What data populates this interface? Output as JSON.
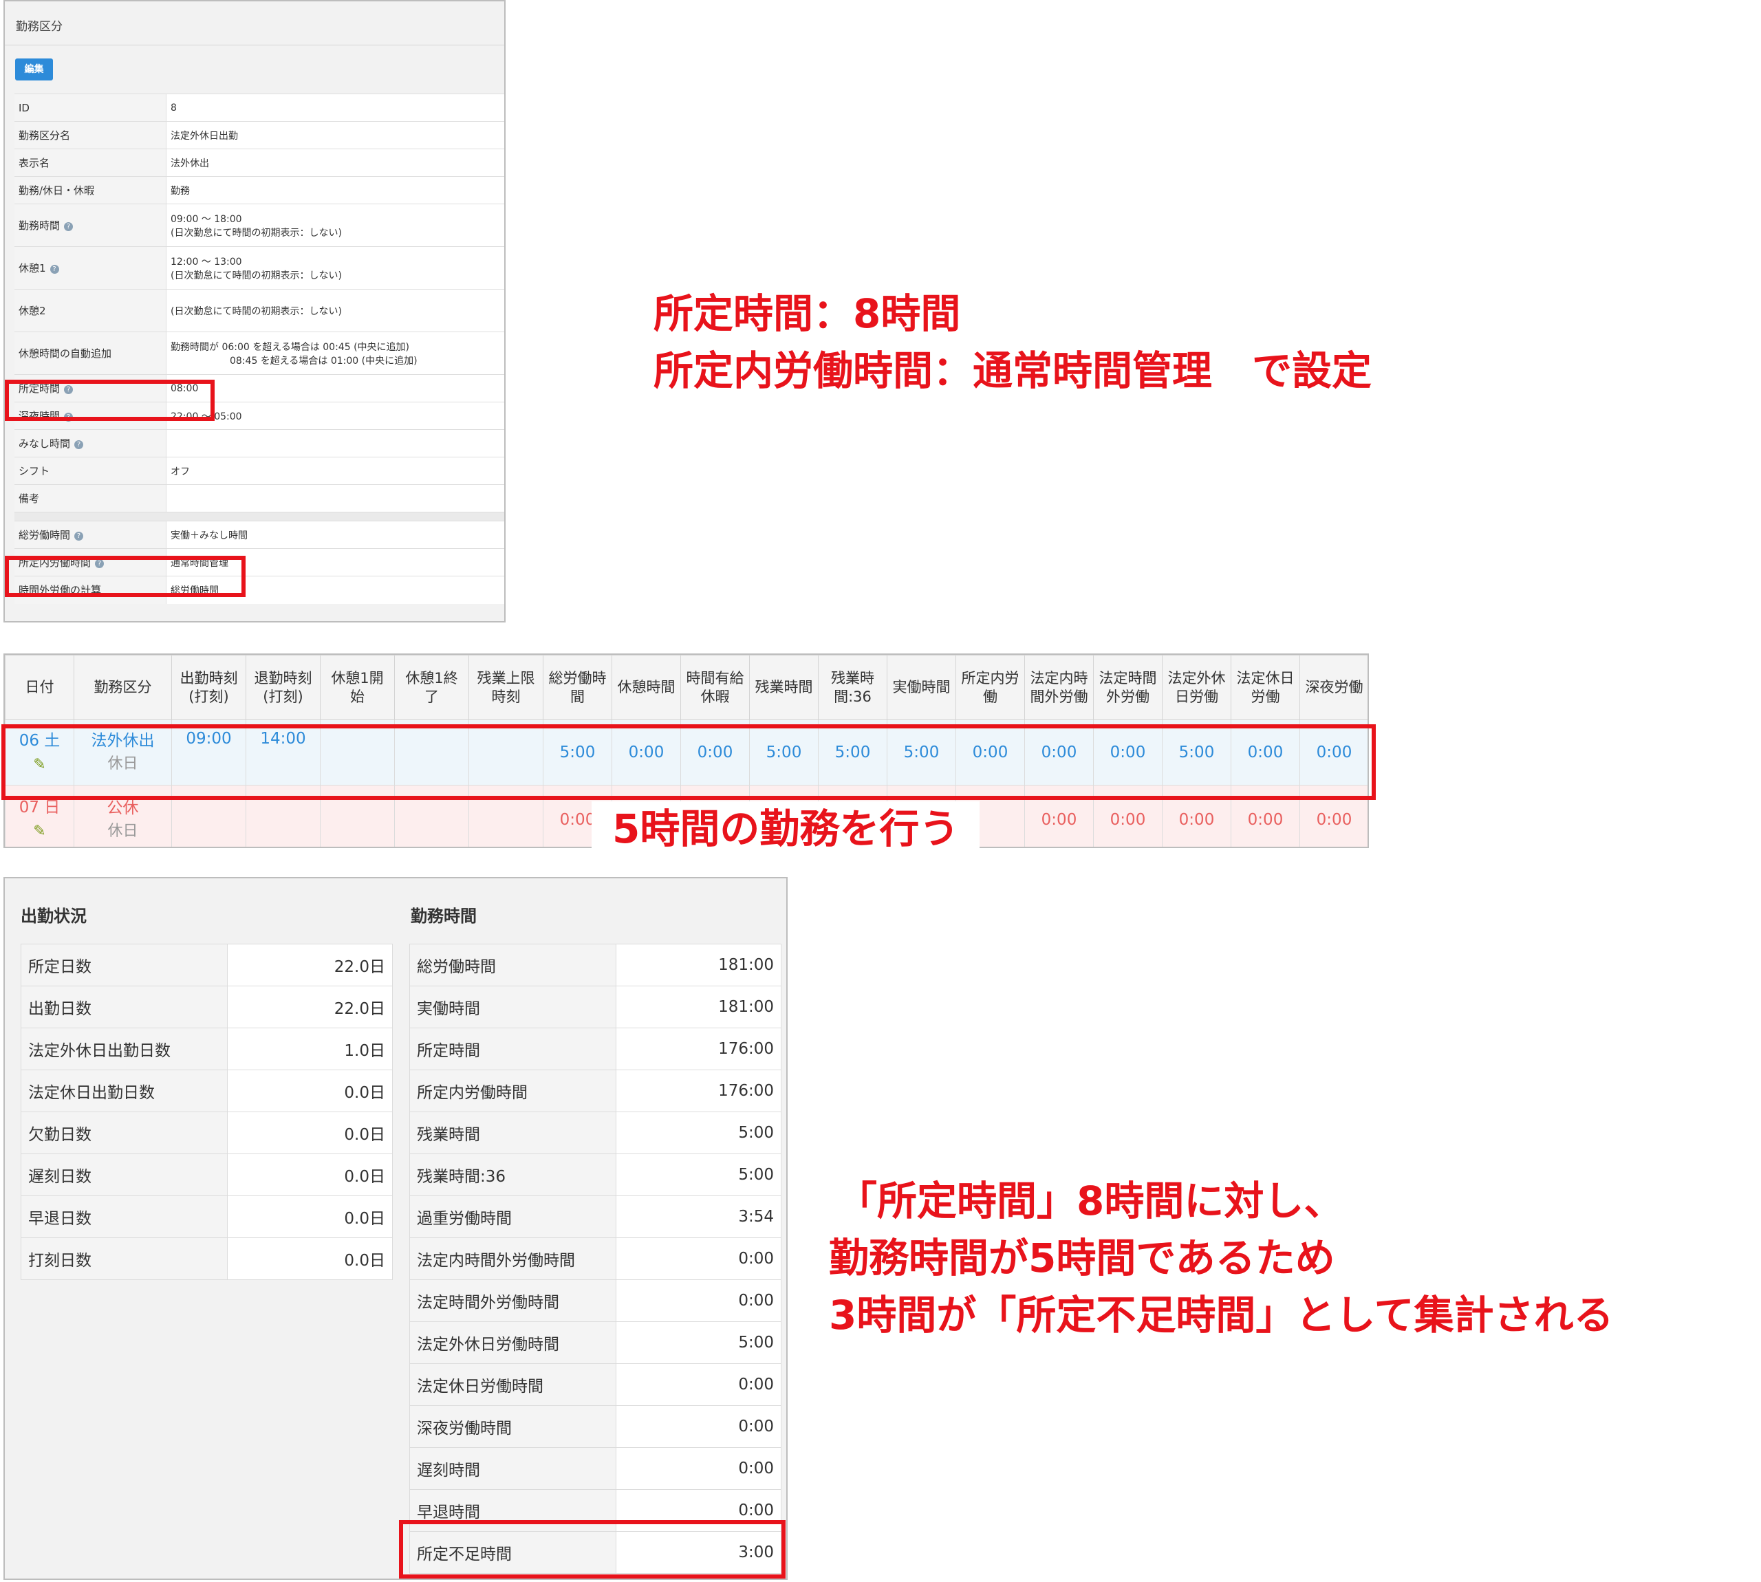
{
  "panel1": {
    "title": "勤務区分",
    "edit_label": "編集",
    "rows": [
      {
        "label": "ID",
        "value": "8"
      },
      {
        "label": "勤務区分名",
        "value": "法定外休日出勤"
      },
      {
        "label": "表示名",
        "value": "法外休出"
      },
      {
        "label": "勤務/休日・休暇",
        "value": "勤務"
      },
      {
        "label": "勤務時間",
        "help": true,
        "value": "09:00 〜 18:00",
        "sub": "(日次勤怠にて時間の初期表示：しない)"
      },
      {
        "label": "休憩1",
        "help": true,
        "value": "12:00 〜 13:00",
        "sub": "(日次勤怠にて時間の初期表示：しない)"
      },
      {
        "label": "休憩2",
        "value": "",
        "sub": "(日次勤怠にて時間の初期表示：しない)"
      },
      {
        "label": "休憩時間の自動追加",
        "value": "勤務時間が 06:00 を超える場合は 00:45 (中央に追加)",
        "sub": "08:45 を超える場合は 01:00 (中央に追加)"
      },
      {
        "label": "所定時間",
        "help": true,
        "value": "08:00"
      },
      {
        "label": "深夜時間",
        "help": true,
        "value": "22:00 〜 05:00"
      },
      {
        "label": "みなし時間",
        "help": true,
        "value": ""
      },
      {
        "label": "シフト",
        "value": "オフ"
      },
      {
        "label": "備考",
        "value": ""
      },
      {
        "label": "総労働時間",
        "help": true,
        "value": "実働＋みなし時間"
      },
      {
        "label": "所定内労働時間",
        "help": true,
        "value": "通常時間管理"
      },
      {
        "label": "時間外労働の計算",
        "value": "総労働時間"
      }
    ]
  },
  "note_top": {
    "line1": "所定時間：8時間",
    "line2": "所定内労働時間：通常時間管理　で設定"
  },
  "timesheet": {
    "headers": [
      "日付",
      "勤務区分",
      "出勤時刻\n(打刻)",
      "退勤時刻\n(打刻)",
      "休憩1開\n始",
      "休憩1終\n了",
      "残業上限\n時刻",
      "総労働時\n間",
      "休憩時間",
      "時間有給\n休暇",
      "残業時間",
      "残業時\n間:36",
      "実働時間",
      "所定内労\n働",
      "法定内時\n間外労働",
      "法定時間\n外労働",
      "法定外休\n日労働",
      "法定休日\n労働",
      "深夜労働"
    ],
    "rows": [
      {
        "date": "06 土",
        "type": "法外休出",
        "holiday": "休日",
        "in": "09:00",
        "out": "14:00",
        "cells": [
          "5:00",
          "0:00",
          "0:00",
          "5:00",
          "5:00",
          "5:00",
          "0:00",
          "0:00",
          "0:00",
          "5:00",
          "0:00",
          "0:00"
        ]
      },
      {
        "date": "07 日",
        "type": "公休",
        "holiday": "休日",
        "in": "",
        "out": "",
        "cells": [
          "0:00",
          "",
          "",
          "",
          "",
          "",
          "",
          "0:00",
          "0:00",
          "0:00",
          "0:00",
          "0:00"
        ]
      }
    ]
  },
  "note_mid": "5時間の勤務を行う",
  "summary": {
    "attendance_title": "出勤状況",
    "attendance": [
      {
        "label": "所定日数",
        "value": "22.0日"
      },
      {
        "label": "出勤日数",
        "value": "22.0日"
      },
      {
        "label": "法定外休日出勤日数",
        "value": "1.0日"
      },
      {
        "label": "法定休日出勤日数",
        "value": "0.0日"
      },
      {
        "label": "欠勤日数",
        "value": "0.0日"
      },
      {
        "label": "遅刻日数",
        "value": "0.0日"
      },
      {
        "label": "早退日数",
        "value": "0.0日"
      },
      {
        "label": "打刻日数",
        "value": "0.0日"
      }
    ],
    "work_title": "勤務時間",
    "work": [
      {
        "label": "総労働時間",
        "value": "181:00"
      },
      {
        "label": "実働時間",
        "value": "181:00"
      },
      {
        "label": "所定時間",
        "value": "176:00"
      },
      {
        "label": "所定内労働時間",
        "value": "176:00"
      },
      {
        "label": "残業時間",
        "value": "5:00"
      },
      {
        "label": "残業時間:36",
        "value": "5:00"
      },
      {
        "label": "過重労働時間",
        "value": "3:54"
      },
      {
        "label": "法定内時間外労働時間",
        "value": "0:00"
      },
      {
        "label": "法定時間外労働時間",
        "value": "0:00"
      },
      {
        "label": "法定外休日労働時間",
        "value": "5:00"
      },
      {
        "label": "法定休日労働時間",
        "value": "0:00"
      },
      {
        "label": "深夜労働時間",
        "value": "0:00"
      },
      {
        "label": "遅刻時間",
        "value": "0:00"
      },
      {
        "label": "早退時間",
        "value": "0:00"
      },
      {
        "label": "所定不足時間",
        "value": "3:00"
      }
    ]
  },
  "note_bottom": {
    "line1": "「所定時間」8時間に対し、",
    "line2": "勤務時間が5時間であるため",
    "line3": "3時間が「所定不足時間」として集計される"
  },
  "colors": {
    "accent_red": "#e8131b",
    "link_blue": "#2d8bd9",
    "weekend_red": "#e9605f"
  },
  "icons": {
    "help": "question-circle-icon",
    "edit": "pencil-icon"
  }
}
